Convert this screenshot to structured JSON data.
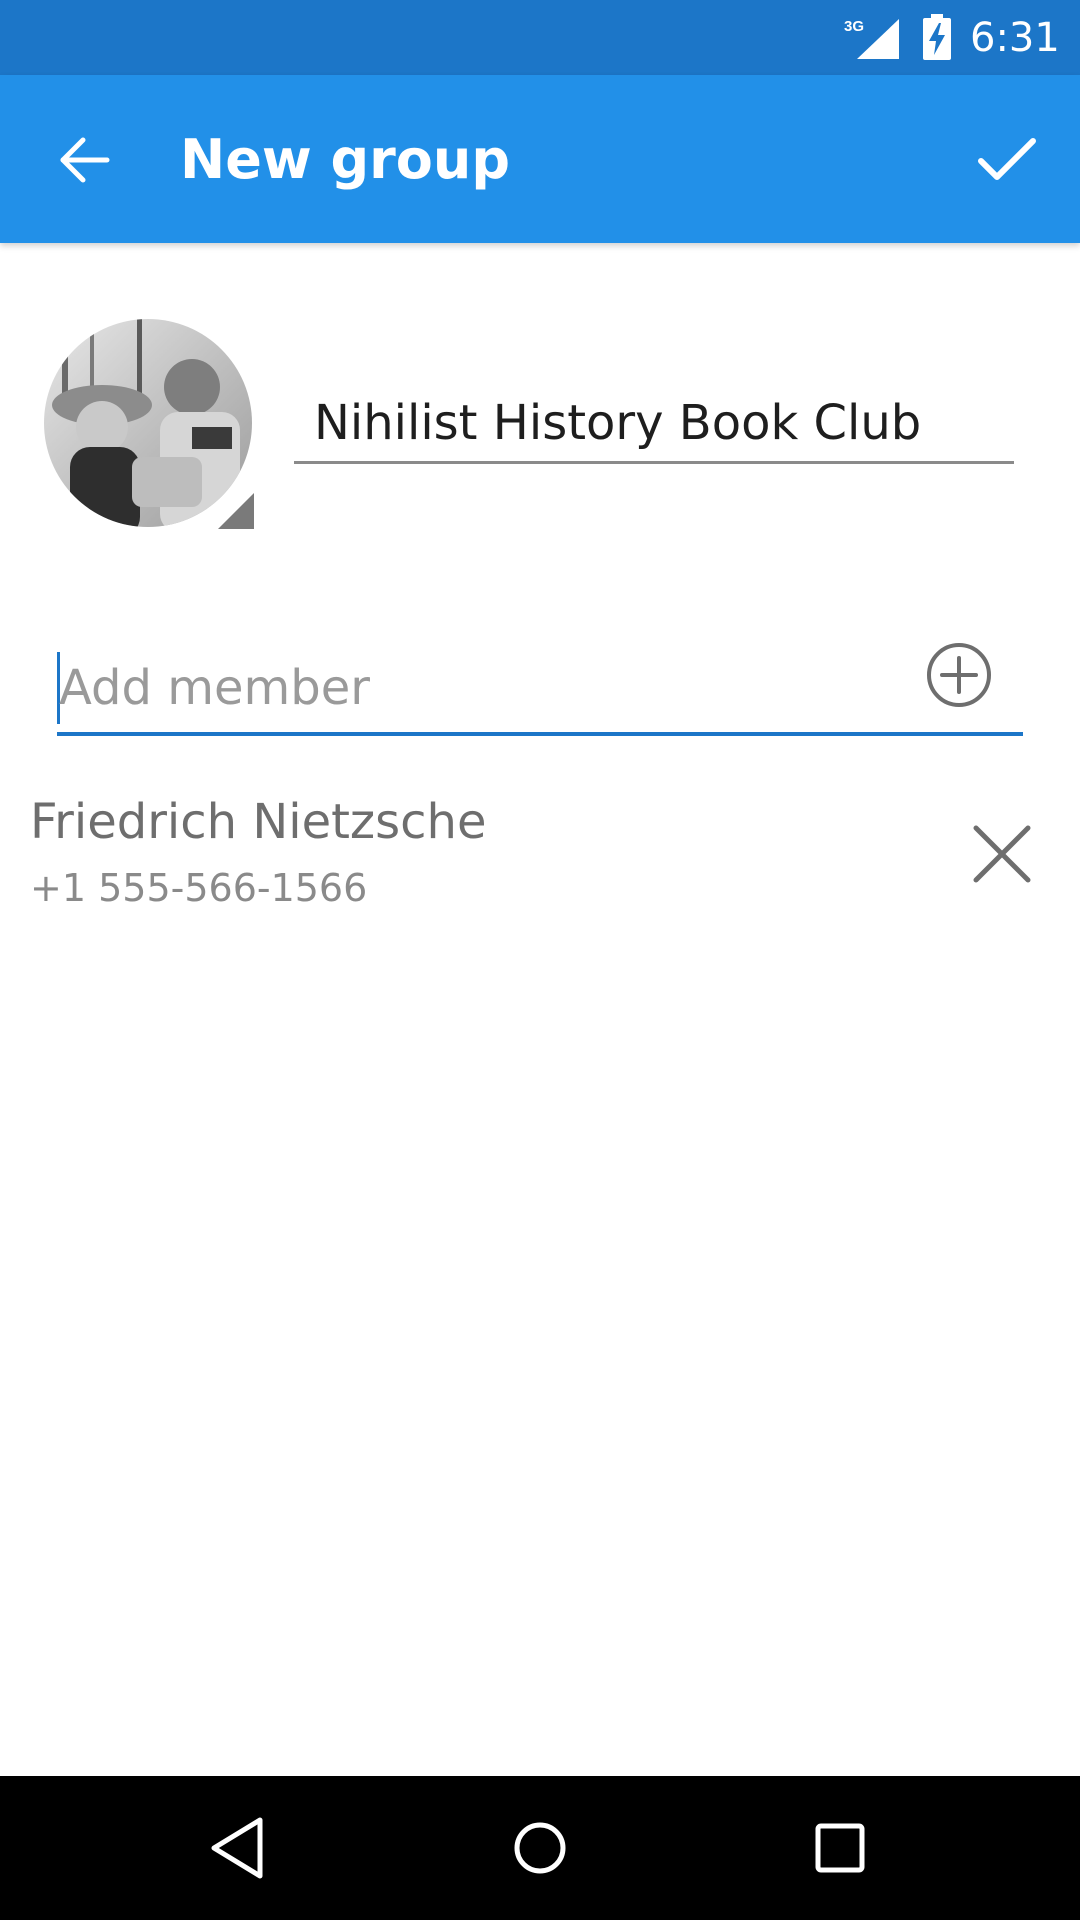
{
  "status_bar": {
    "network": "3G",
    "time": "6:31",
    "icons": [
      "signal-3g-icon",
      "battery-charging-icon"
    ]
  },
  "app_bar": {
    "title": "New group",
    "icons": [
      "back-arrow-icon",
      "check-icon"
    ],
    "color": "#2290e8"
  },
  "group": {
    "name": "Nihilist History Book Club"
  },
  "add_member": {
    "placeholder": "Add member",
    "icon": "add-circle-icon",
    "accent": "#1c76c8"
  },
  "members": [
    {
      "name": "Friedrich Nietzsche",
      "phone": "+1 555-566-1566",
      "icon": "remove-x-icon"
    }
  ],
  "nav_bar": {
    "icons": [
      "nav-back-icon",
      "nav-home-icon",
      "nav-recents-icon"
    ]
  }
}
